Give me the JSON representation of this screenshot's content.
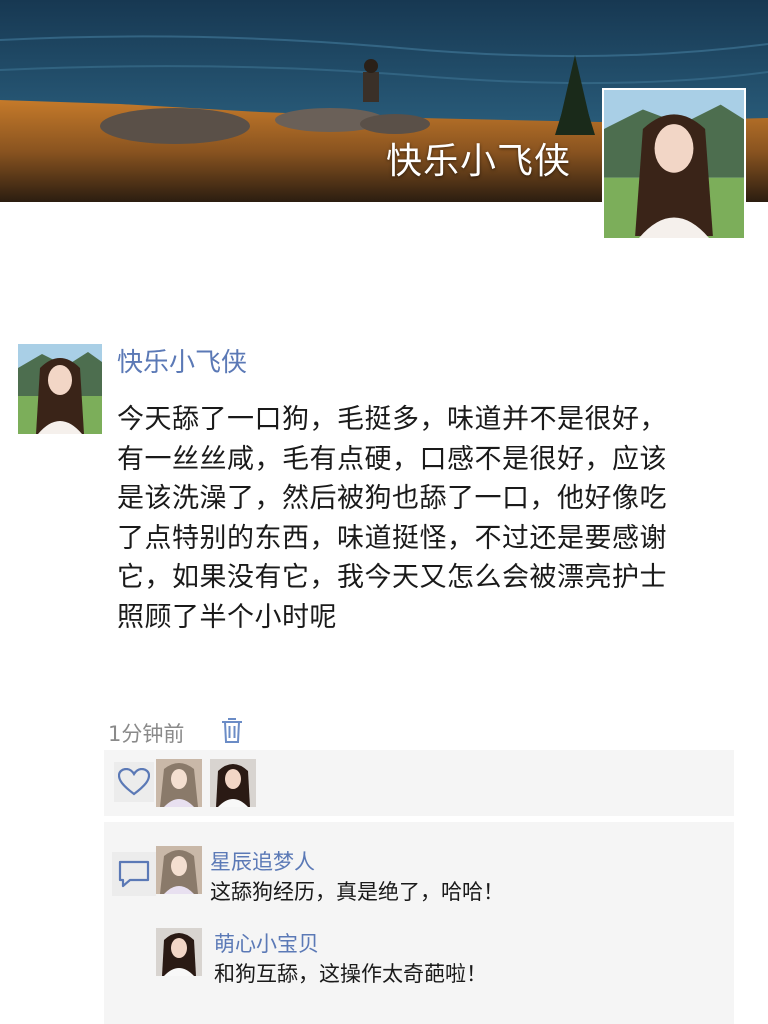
{
  "cover": {
    "username": "快乐小飞侠"
  },
  "post": {
    "author": "快乐小飞侠",
    "text_lines": [
      "今天舔了一口狗，毛挺多，味道并不是很好，",
      "有一丝丝咸，毛有点硬，口感不是很好，应该",
      "是该洗澡了，然后被狗也舔了一口，他好像吃",
      "了点特别的东西，味道挺怪，不过还是要感谢",
      "它，如果没有它，我今天又怎么会被漂亮护士",
      "照顾了半个小时呢"
    ],
    "time": "1分钟前"
  },
  "likes": {
    "icon": "heart-outline-icon",
    "users": [
      "like-avatar-1",
      "like-avatar-2"
    ]
  },
  "comments": {
    "icon": "comment-bubble-icon",
    "items": [
      {
        "name": "星辰追梦人",
        "text": "这舔狗经历，真是绝了，哈哈！"
      },
      {
        "name": "萌心小宝贝",
        "text": "和狗互舔，这操作太奇葩啦！"
      }
    ]
  },
  "colors": {
    "link_blue": "#5b79b6",
    "text": "#1a1a1a",
    "meta_gray": "#8a8a8a",
    "panel_bg": "#f5f5f5"
  }
}
